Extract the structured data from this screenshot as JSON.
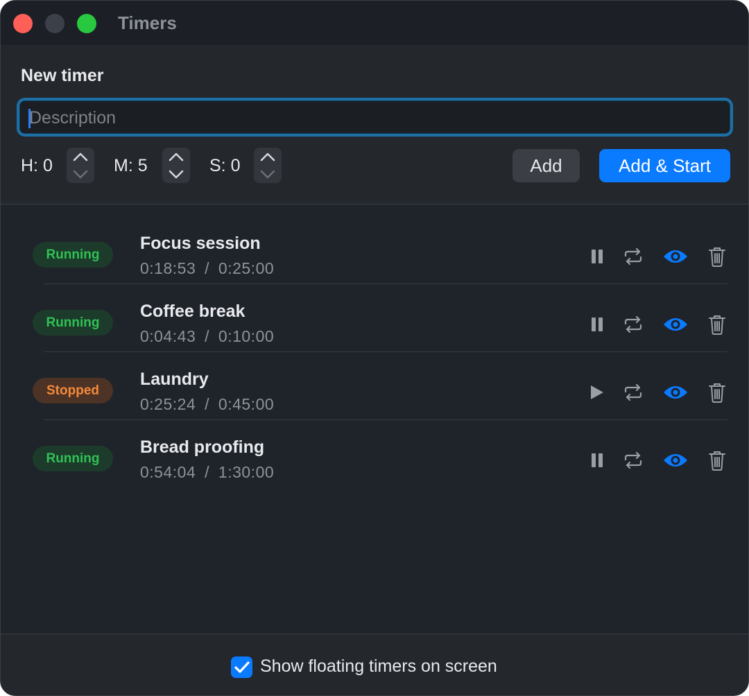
{
  "window": {
    "title": "Timers"
  },
  "new_timer": {
    "heading": "New timer",
    "description_placeholder": "Description",
    "description_value": "",
    "hours_label": "H: 0",
    "minutes_label": "M: 5",
    "seconds_label": "S: 0",
    "add_label": "Add",
    "add_start_label": "Add & Start"
  },
  "timers": [
    {
      "status": "Running",
      "name": "Focus session",
      "elapsed": "0:18:53",
      "total": "0:25:00",
      "action": "pause"
    },
    {
      "status": "Running",
      "name": "Coffee break",
      "elapsed": "0:04:43",
      "total": "0:10:00",
      "action": "pause"
    },
    {
      "status": "Stopped",
      "name": "Laundry",
      "elapsed": "0:25:24",
      "total": "0:45:00",
      "action": "play"
    },
    {
      "status": "Running",
      "name": "Bread proofing",
      "elapsed": "0:54:04",
      "total": "1:30:00",
      "action": "pause"
    }
  ],
  "footer": {
    "show_floating_label": "Show floating timers on screen",
    "show_floating_checked": true
  },
  "colors": {
    "accent": "#0a7aff",
    "running": "#2fc254",
    "stopped": "#f58a3a",
    "close": "#fe5f57",
    "maximize": "#28c840"
  },
  "icons": {
    "pause": "pause-icon",
    "play": "play-icon",
    "repeat": "repeat-icon",
    "show": "eye-icon",
    "delete": "trash-icon"
  }
}
